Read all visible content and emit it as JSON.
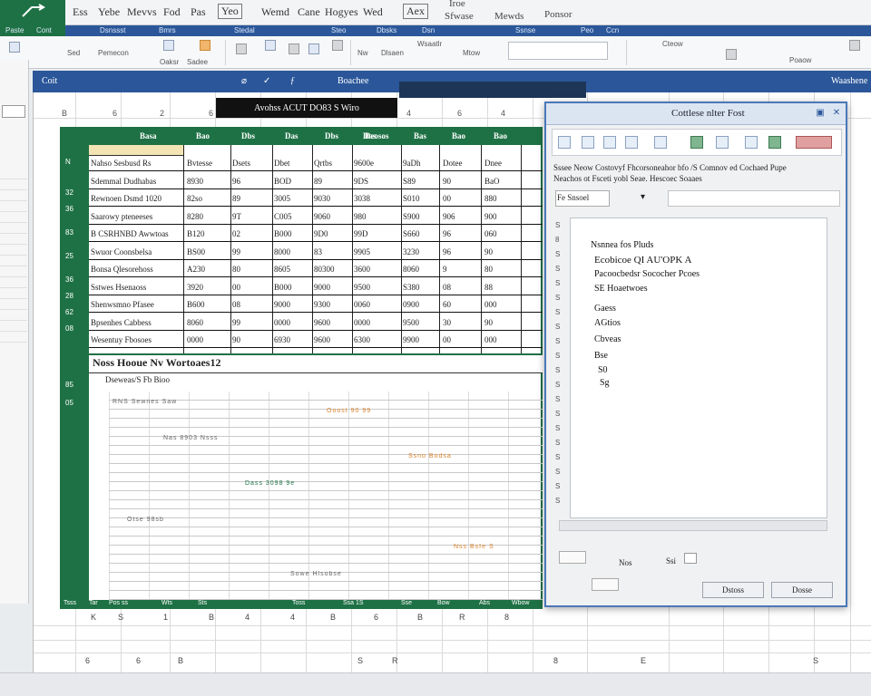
{
  "tabs": [
    "Ess",
    "Yebe",
    "Mevvs",
    "Fod",
    "Pas",
    "Yeo",
    "Wemd",
    "Cane",
    "Hogyes",
    "Wed",
    "Aex",
    "Iroe",
    "Sfwase",
    "Mewds",
    "Ponsor"
  ],
  "active_tab_index": 5,
  "groups": [
    "Paste",
    "Cont",
    "Dsnssst",
    "Bmrs",
    "Stedal",
    "Steo",
    "Dbsks",
    "Dsn",
    "Ssnse",
    "Peo",
    "Ccn"
  ],
  "ribbon": {
    "labels": [
      "Sed",
      "Pemecon",
      "Oaksr",
      "Sadee",
      "Nw",
      "Dlsaen",
      "Wsaatlr",
      "Mtow",
      "Cteow",
      "Poaow"
    ]
  },
  "formula_bar": {
    "name_box": "Coit",
    "items": [
      "Boachee",
      "Waashene"
    ]
  },
  "black_bar_text": "Avohss ACUT DO83  S    Wiro",
  "column_numbers": [
    "B",
    "6",
    "2",
    "6",
    "4",
    "6",
    "4",
    "8",
    "0"
  ],
  "table": {
    "headers": [
      "Basa",
      "Bao",
      "Dbs",
      "Das",
      "Dbs",
      "Das",
      "Deosos",
      "Bas",
      "Bao",
      "Bao"
    ],
    "row_labels": [
      "N",
      "32",
      "36",
      "83",
      "25",
      "36",
      "28",
      "62",
      "08",
      "85",
      "05"
    ],
    "rows": [
      [
        "Nahso Sesbusd Rs",
        "Bvtesse",
        "Dsets",
        "Dbet",
        "Qrtbs",
        "9600e",
        "9aDh",
        "Dotee",
        "Dnee"
      ],
      [
        "Sdemmal Dudhabas",
        "8930",
        "96",
        "BOD",
        "89",
        "9DS",
        "S89",
        "90",
        "BaO"
      ],
      [
        "Rewnoen Dsmd 1020",
        "82so",
        "89",
        "3005",
        "9030",
        "3038",
        "S010",
        "00",
        "880"
      ],
      [
        "Saarowy pteneeses",
        "8280",
        "9T",
        "C005",
        "9060",
        "980",
        "S900",
        "906",
        "900"
      ],
      [
        "B CSRHNBD Awwtoas",
        "B120",
        "02",
        "B000",
        "9D0",
        "99D",
        "S660",
        "96",
        "060"
      ],
      [
        "Swuor Coonsbelsa",
        "BS00",
        "99",
        "8000",
        "83",
        "9905",
        "3230",
        "96",
        "90"
      ],
      [
        "Bonsa Qlesorehoss",
        "A230",
        "80",
        "8605",
        "80300",
        "3600",
        "8060",
        "9",
        "80"
      ],
      [
        "Sstwes Hsenaoss",
        "3920",
        "00",
        "B000",
        "9000",
        "9500",
        "S380",
        "08",
        "88"
      ],
      [
        "Shenwsmno Pfasee",
        "B600",
        "08",
        "9000",
        "9300",
        "0060",
        "0900",
        "60",
        "000"
      ],
      [
        "Bpsenhes Cabbess",
        "8060",
        "99",
        "0000",
        "9600",
        "0000",
        "9500",
        "30",
        "90"
      ],
      [
        "Wesentuy Fbosoes",
        "0000",
        "90",
        "6930",
        "9600",
        "6300",
        "9900",
        "00",
        "000"
      ]
    ],
    "section2_title": "Noss Hooue Nv Wortoaes12",
    "section2_sub": "Dseweas/S Fb Bioo",
    "dense_samples": [
      "RNS  Sewnes Saw",
      "Ooost 90 99",
      "Nas 8903 Nsss",
      "Ssno Bodsa",
      "Dass 3098 9e",
      "Otse 98sb",
      "Nss Bsfe S",
      "Sowe Hlsobse"
    ],
    "footer": [
      "Tsss",
      "Tar",
      "Pos ss",
      "Wts",
      "Sts",
      "Toss",
      "Ssa 1S",
      "Sse",
      "Bow",
      "Abs",
      "Wbow"
    ]
  },
  "dialog": {
    "title": "Cottlese nlter Fost",
    "description_line1": "Sssee Neow Costovyf Fhcorsoneahor bfo /S Comnov ed Cochaed Pupe",
    "description_line2": "Neachos ot Fsceti yobl         Seae.    Hescoec Soaaes",
    "field_label": "Fe Snsoel",
    "list_items": [
      "Nsnnea fos Pluds",
      "Ecobicoe QI AU'OPK A",
      "Pacoocbedsr Sococher Pcoes",
      "SE  Hoaetwoes",
      "Gaess",
      "AGtios",
      "Cbveas",
      "Bse",
      "S0",
      "Sg"
    ],
    "left_marks": [
      "S",
      "8",
      "S",
      "S",
      "S",
      "S",
      "S",
      "S",
      "S",
      "S",
      "S",
      "S",
      "S",
      "S",
      "S",
      "S",
      "S",
      "S",
      "S",
      "S"
    ],
    "bottom_label1": "Nos",
    "bottom_label2": "Ssi",
    "ok_button": "Dstoss",
    "cancel_button": "Dosse"
  },
  "bottom_numbers": [
    "K",
    "S",
    "1",
    "B",
    "4",
    "4",
    "B",
    "6",
    "B",
    "R",
    "8"
  ],
  "bottom_numbers2": [
    "6",
    "6",
    "B",
    "S",
    "R",
    "8",
    "E",
    "S"
  ]
}
